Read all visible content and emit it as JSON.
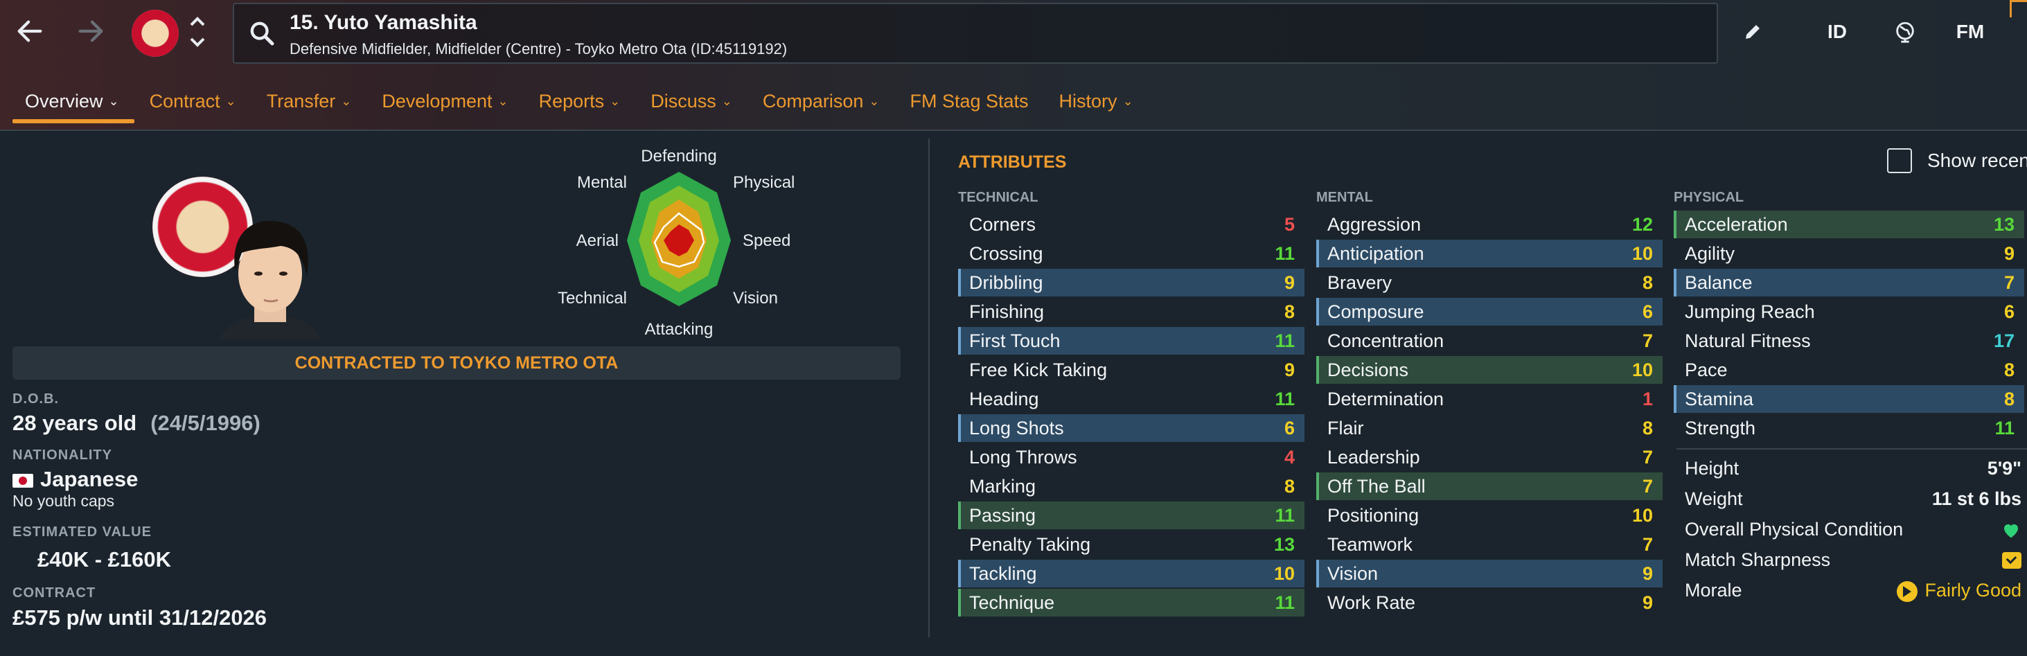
{
  "header": {
    "player_title": "15. Yuto Yamashita",
    "player_subtitle": "Defensive Midfielder, Midfielder (Centre) - Toyko Metro Ota (ID:45119192)",
    "icon_id_label": "ID",
    "icon_fm_label": "FM"
  },
  "tabs": [
    {
      "label": "Overview",
      "chevron": true
    },
    {
      "label": "Contract",
      "chevron": true
    },
    {
      "label": "Transfer",
      "chevron": true
    },
    {
      "label": "Development",
      "chevron": true
    },
    {
      "label": "Reports",
      "chevron": true
    },
    {
      "label": "Discuss",
      "chevron": true
    },
    {
      "label": "Comparison",
      "chevron": true
    },
    {
      "label": "FM Stag Stats",
      "chevron": false
    },
    {
      "label": "History",
      "chevron": true
    }
  ],
  "profile": {
    "contract_banner": "CONTRACTED TO TOYKO METRO OTA",
    "dob_label": "D.O.B.",
    "dob_age": "28 years old",
    "dob_date": "(24/5/1996)",
    "nationality_label": "NATIONALITY",
    "nationality": "Japanese",
    "youth_caps": "No youth caps",
    "value_label": "ESTIMATED VALUE",
    "value": "£40K - £160K",
    "contract_label": "CONTRACT",
    "contract": "£575 p/w until 31/12/2026"
  },
  "radar": {
    "labels": {
      "defending": "Defending",
      "physical": "Physical",
      "speed": "Speed",
      "vision": "Vision",
      "attacking": "Attacking",
      "technical": "Technical",
      "aerial": "Aerial",
      "mental": "Mental"
    }
  },
  "attributes": {
    "title": "ATTRIBUTES",
    "show_recent": "Show recen",
    "technical_header": "TECHNICAL",
    "mental_header": "MENTAL",
    "physical_header": "PHYSICAL",
    "technical": [
      {
        "name": "Corners",
        "value": "5",
        "hl": ""
      },
      {
        "name": "Crossing",
        "value": "11",
        "hl": ""
      },
      {
        "name": "Dribbling",
        "value": "9",
        "hl": "blue"
      },
      {
        "name": "Finishing",
        "value": "8",
        "hl": ""
      },
      {
        "name": "First Touch",
        "value": "11",
        "hl": "blue"
      },
      {
        "name": "Free Kick Taking",
        "value": "9",
        "hl": ""
      },
      {
        "name": "Heading",
        "value": "11",
        "hl": ""
      },
      {
        "name": "Long Shots",
        "value": "6",
        "hl": "blue"
      },
      {
        "name": "Long Throws",
        "value": "4",
        "hl": ""
      },
      {
        "name": "Marking",
        "value": "8",
        "hl": ""
      },
      {
        "name": "Passing",
        "value": "11",
        "hl": "green"
      },
      {
        "name": "Penalty Taking",
        "value": "13",
        "hl": ""
      },
      {
        "name": "Tackling",
        "value": "10",
        "hl": "blue"
      },
      {
        "name": "Technique",
        "value": "11",
        "hl": "green"
      }
    ],
    "mental": [
      {
        "name": "Aggression",
        "value": "12",
        "hl": ""
      },
      {
        "name": "Anticipation",
        "value": "10",
        "hl": "blue"
      },
      {
        "name": "Bravery",
        "value": "8",
        "hl": ""
      },
      {
        "name": "Composure",
        "value": "6",
        "hl": "blue"
      },
      {
        "name": "Concentration",
        "value": "7",
        "hl": ""
      },
      {
        "name": "Decisions",
        "value": "10",
        "hl": "green"
      },
      {
        "name": "Determination",
        "value": "1",
        "hl": ""
      },
      {
        "name": "Flair",
        "value": "8",
        "hl": ""
      },
      {
        "name": "Leadership",
        "value": "7",
        "hl": ""
      },
      {
        "name": "Off The Ball",
        "value": "7",
        "hl": "green"
      },
      {
        "name": "Positioning",
        "value": "10",
        "hl": ""
      },
      {
        "name": "Teamwork",
        "value": "7",
        "hl": ""
      },
      {
        "name": "Vision",
        "value": "9",
        "hl": "blue"
      },
      {
        "name": "Work Rate",
        "value": "9",
        "hl": ""
      }
    ],
    "physical": [
      {
        "name": "Acceleration",
        "value": "13",
        "hl": "green"
      },
      {
        "name": "Agility",
        "value": "9",
        "hl": ""
      },
      {
        "name": "Balance",
        "value": "7",
        "hl": "blue"
      },
      {
        "name": "Jumping Reach",
        "value": "6",
        "hl": ""
      },
      {
        "name": "Natural Fitness",
        "value": "17",
        "hl": ""
      },
      {
        "name": "Pace",
        "value": "8",
        "hl": ""
      },
      {
        "name": "Stamina",
        "value": "8",
        "hl": "blue"
      },
      {
        "name": "Strength",
        "value": "11",
        "hl": ""
      }
    ],
    "extra": {
      "height_label": "Height",
      "height": "5'9\"",
      "weight_label": "Weight",
      "weight": "11 st 6 lbs",
      "condition_label": "Overall Physical Condition",
      "sharpness_label": "Match Sharpness",
      "morale_label": "Morale",
      "morale": "Fairly Good"
    }
  },
  "colors": {
    "accent": "#ee9a2e",
    "val_red": "#ee4f4f",
    "val_yellow": "#f2d024",
    "val_green": "#58d93a",
    "val_cyan": "#3fd1d4",
    "radar_green": "#2ea84a",
    "radar_lime": "#7fbf2c",
    "radar_orange": "#e0a21a",
    "radar_red": "#cc1111"
  }
}
